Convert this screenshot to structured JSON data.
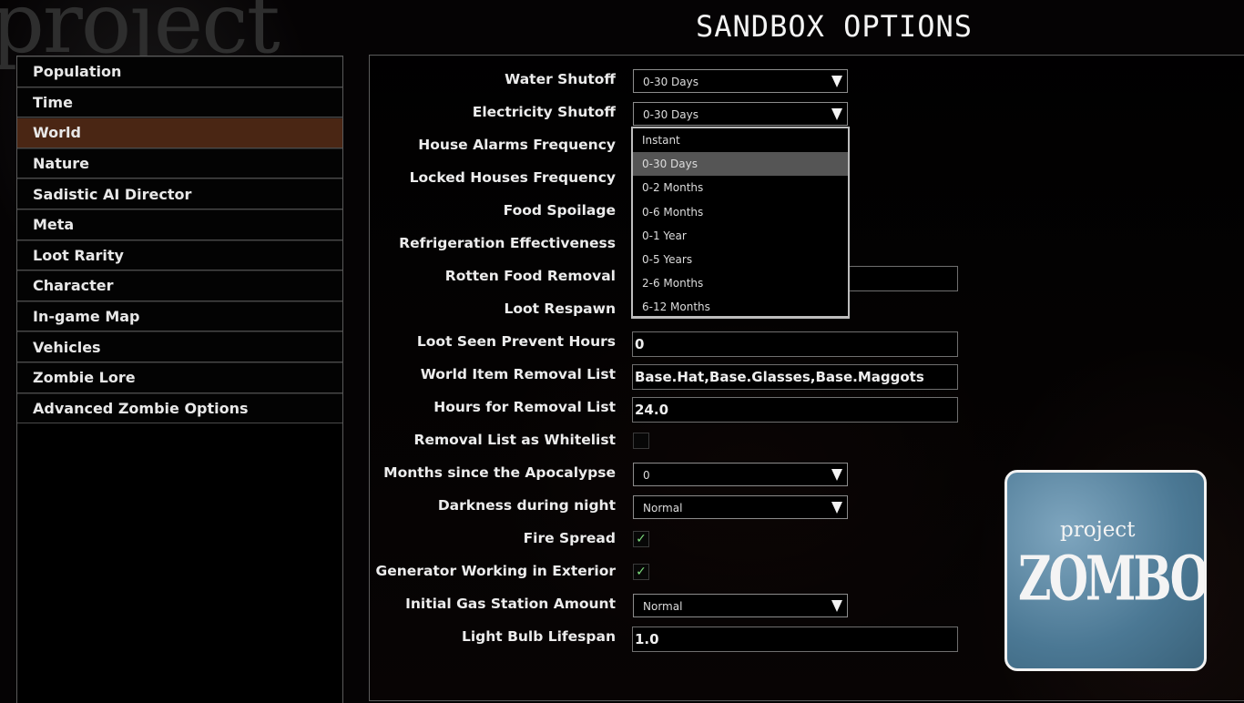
{
  "header": {
    "title": "SANDBOX OPTIONS"
  },
  "background": {
    "logo_text": "project",
    "logo_word": "ZOMBOID"
  },
  "sidebar": {
    "items": [
      {
        "label": "Population",
        "active": false
      },
      {
        "label": "Time",
        "active": false
      },
      {
        "label": "World",
        "active": true
      },
      {
        "label": "Nature",
        "active": false
      },
      {
        "label": "Sadistic AI Director",
        "active": false
      },
      {
        "label": "Meta",
        "active": false
      },
      {
        "label": "Loot Rarity",
        "active": false
      },
      {
        "label": "Character",
        "active": false
      },
      {
        "label": "In-game Map",
        "active": false
      },
      {
        "label": "Vehicles",
        "active": false
      },
      {
        "label": "Zombie Lore",
        "active": false
      },
      {
        "label": "Advanced Zombie Options",
        "active": false
      }
    ]
  },
  "settings": [
    {
      "label": "Water Shutoff",
      "type": "combo",
      "value": "0-30 Days"
    },
    {
      "label": "Electricity Shutoff",
      "type": "combo",
      "value": "0-30 Days"
    },
    {
      "label": "House Alarms Frequency",
      "type": "hidden"
    },
    {
      "label": "Locked Houses Frequency",
      "type": "hidden"
    },
    {
      "label": "Food Spoilage",
      "type": "hidden"
    },
    {
      "label": "Refrigeration Effectiveness",
      "type": "hidden"
    },
    {
      "label": "Rotten Food Removal",
      "type": "text",
      "value": ""
    },
    {
      "label": "Loot Respawn",
      "type": "hidden"
    },
    {
      "label": "Loot Seen Prevent Hours",
      "type": "text",
      "value": "0"
    },
    {
      "label": "World Item Removal List",
      "type": "text",
      "value": "Base.Hat,Base.Glasses,Base.Maggots"
    },
    {
      "label": "Hours for Removal List",
      "type": "text",
      "value": "24.0"
    },
    {
      "label": "Removal List as Whitelist",
      "type": "checkbox",
      "checked": false
    },
    {
      "label": "Months since the Apocalypse",
      "type": "combo",
      "value": "0"
    },
    {
      "label": "Darkness during night",
      "type": "combo",
      "value": "Normal"
    },
    {
      "label": "Fire Spread",
      "type": "checkbox",
      "checked": true
    },
    {
      "label": "Generator Working in Exterior",
      "type": "checkbox",
      "checked": true
    },
    {
      "label": "Initial Gas Station Amount",
      "type": "combo",
      "value": "Normal"
    },
    {
      "label": "Light Bulb Lifespan",
      "type": "text",
      "value": "1.0"
    }
  ],
  "dropdown": {
    "for": "Electricity Shutoff",
    "selected": "0-30 Days",
    "options": [
      "Instant",
      "0-30 Days",
      "0-2 Months",
      "0-6 Months",
      "0-1 Year",
      "0-5 Years",
      "2-6 Months",
      "6-12 Months"
    ]
  },
  "icons": {
    "dropdown_arrow": "triangle-down-icon",
    "checkmark": "✓"
  },
  "logo_card": {
    "small": "project",
    "big": "ZOMBOID"
  }
}
